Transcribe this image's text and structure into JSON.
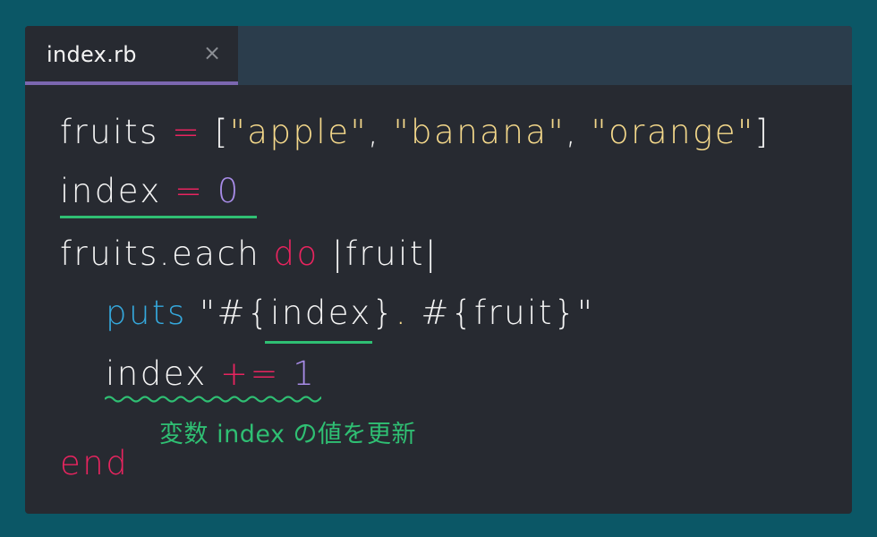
{
  "tab": {
    "filename": "index.rb",
    "close_glyph": "×"
  },
  "code": {
    "line1": {
      "ident": "fruits",
      "op": "=",
      "open": "[",
      "s1": "\"apple\"",
      "c1": ",",
      "s2": "\"banana\"",
      "c2": ",",
      "s3": "\"orange\"",
      "close": "]"
    },
    "line2": {
      "ident": "index",
      "op": "=",
      "num": "0"
    },
    "line3": {
      "ident": "fruits.each",
      "kw": "do",
      "block": "|fruit|"
    },
    "line4": {
      "fn": "puts",
      "q1": "\"#{",
      "interp": "index",
      "mid": "}",
      "dot": ".",
      "rest": "#{fruit}\""
    },
    "line5": {
      "ident": "index",
      "op": "+=",
      "num": "1"
    },
    "line6": {
      "kw": "end"
    }
  },
  "annotation": {
    "note": "変数 index の値を更新"
  },
  "colors": {
    "background": "#0b5766",
    "editor": "#272a31",
    "tabbar": "#2b3d4c",
    "tab_accent": "#7b67b0",
    "keyword": "#e8245f",
    "string": "#f5d98b",
    "number": "#a88ce8",
    "function": "#35a8dc",
    "annotation": "#2fbf73"
  }
}
